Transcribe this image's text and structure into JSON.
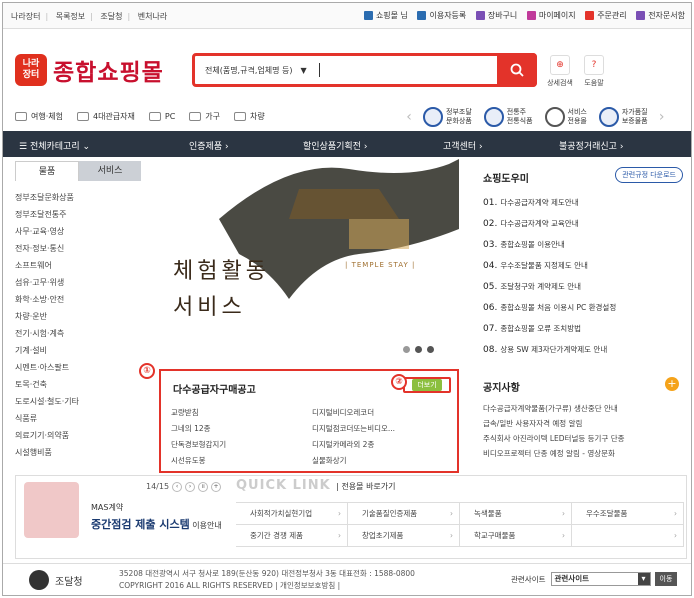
{
  "topbar": {
    "left": [
      "나라장터",
      "목록정보",
      "조달청",
      "벤처나라"
    ],
    "right": [
      {
        "label": "쇼핑몰 님",
        "color": "#2b6cb0"
      },
      {
        "label": "이용자등록",
        "color": "#2b6cb0"
      },
      {
        "label": "장바구니",
        "color": "#7a4fb5"
      },
      {
        "label": "마이페이지",
        "color": "#c03a9a"
      },
      {
        "label": "주문관리",
        "color": "#e3332a"
      },
      {
        "label": "전자문서함",
        "color": "#7a4fb5"
      }
    ]
  },
  "logo": {
    "mark": "나라\n장터",
    "text": "종합쇼핑몰"
  },
  "search": {
    "category": "전체(품명,규격,업체명 등)"
  },
  "tools": [
    {
      "label": "상세검색"
    },
    {
      "label": "도움말"
    }
  ],
  "quick": [
    "여행·체험",
    "4대관급자재",
    "PC",
    "가구",
    "차량"
  ],
  "promo": [
    "정부조달\n문화상품",
    "전통주\n전통식품",
    "서비스\n전용몰",
    "자가품질\n보증물품"
  ],
  "nav": {
    "all": "전체카테고리",
    "items": [
      "인증제품",
      "할인상품기획전",
      "고객센터",
      "불공정거래신고"
    ]
  },
  "side": {
    "tabs": [
      "물품",
      "서비스"
    ],
    "items": [
      "정부조달문화상품",
      "정부조달전통주",
      "사무·교육·영상",
      "전자·정보·통신",
      "소프트웨어",
      "섬유·고무·위생",
      "화학·소방·안전",
      "차량·운반",
      "전기·시험·계측",
      "기계·설비",
      "시멘트·아스팔트",
      "토목·건축",
      "도로시설·철도·기타",
      "식품류",
      "의료기기·의약품",
      "시설행비품"
    ]
  },
  "banner": {
    "line1": "체험활동",
    "line2": "서비스",
    "sub": "| TEMPLE STAY |"
  },
  "helper": {
    "title": "쇼핑도우미",
    "download": "관련규정 다운로드",
    "items": [
      {
        "n": "01.",
        "t": "다수공급자계약 제도안내"
      },
      {
        "n": "02.",
        "t": "다수공급자계약 교육안내"
      },
      {
        "n": "03.",
        "t": "종합쇼핑몰 이용안내"
      },
      {
        "n": "04.",
        "t": "우수조달물품 지정제도 안내"
      },
      {
        "n": "05.",
        "t": "조달청구와 계약제도 안내"
      },
      {
        "n": "06.",
        "t": "종합쇼핑몰 처음 이용시 PC 환경설정"
      },
      {
        "n": "07.",
        "t": "종합쇼핑몰 오류 조치방법"
      },
      {
        "n": "08.",
        "t": "상용 SW 제3자단가계약제도 안내"
      }
    ]
  },
  "mas_notice": {
    "title": "다수공급자구매공고",
    "more": "더보기",
    "marker1": "①",
    "marker2": "②",
    "items": [
      "교량받침",
      "디지털비디오레코더",
      "그네의 12종",
      "디지털점코더또는비디오...",
      "단독경보형감지기",
      "디지털카메라외 2종",
      "시선유도봉",
      "실물화상기"
    ]
  },
  "announce": {
    "title": "공지사항",
    "items": [
      "다수공급자계약물품(가구류) 생산중단 안내",
      "급속/일반 사용자자격 예정 알림",
      "주식회사 아진라이텍 LED터널등 등기구 단종",
      "비디오프로젝터 단종 예정 알림 - 영상문화"
    ]
  },
  "mas": {
    "page": "14/15",
    "t1": "MAS계약",
    "t2": "중간점검 제출 시스템",
    "t2b": " 이용안내"
  },
  "quicklink": {
    "title": "QUICK LINK",
    "sub": "| 전용몰 바로가기",
    "items": [
      "사회적가치실현기업",
      "기술품질인증제품",
      "녹색물품",
      "우수조달물품",
      "중기간 경쟁 제품",
      "창업초기제품",
      "학교구매물품",
      ""
    ]
  },
  "footer": {
    "org": "조달청",
    "addr1": "35208 대전광역시 서구 청사로 189(둔산동 920) 대전정부청사 3동 대표전화 : 1588-0800",
    "addr2": "COPYRIGHT 2016 ALL RIGHTS RESERVED | 개인정보보호방침 |",
    "rel_label": "관련사이트",
    "rel_value": "관련사이트",
    "go": "이동"
  }
}
